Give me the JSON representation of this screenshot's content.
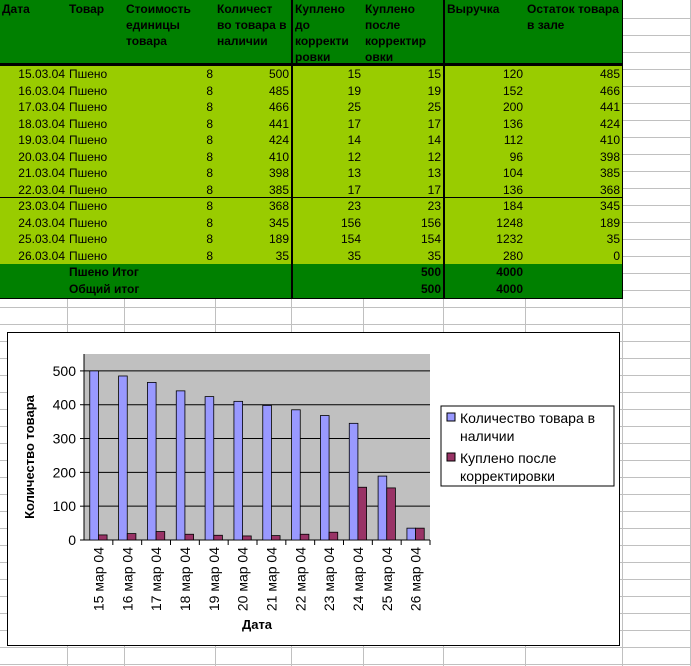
{
  "table": {
    "headers": [
      "Дата",
      "Товар",
      "Стоимость единицы товара",
      "Количест во товара в наличии",
      "Куплено до корректи ровки",
      "Куплено после корректир овки",
      "Выручка",
      "Остаток товара в зале"
    ],
    "rows": [
      [
        "15.03.04",
        "Пшено",
        "8",
        "500",
        "15",
        "15",
        "120",
        "485"
      ],
      [
        "16.03.04",
        "Пшено",
        "8",
        "485",
        "19",
        "19",
        "152",
        "466"
      ],
      [
        "17.03.04",
        "Пшено",
        "8",
        "466",
        "25",
        "25",
        "200",
        "441"
      ],
      [
        "18.03.04",
        "Пшено",
        "8",
        "441",
        "17",
        "17",
        "136",
        "424"
      ],
      [
        "19.03.04",
        "Пшено",
        "8",
        "424",
        "14",
        "14",
        "112",
        "410"
      ],
      [
        "20.03.04",
        "Пшено",
        "8",
        "410",
        "12",
        "12",
        "96",
        "398"
      ],
      [
        "21.03.04",
        "Пшено",
        "8",
        "398",
        "13",
        "13",
        "104",
        "385"
      ],
      [
        "22.03.04",
        "Пшено",
        "8",
        "385",
        "17",
        "17",
        "136",
        "368"
      ],
      [
        "23.03.04",
        "Пшено",
        "8",
        "368",
        "23",
        "23",
        "184",
        "345"
      ],
      [
        "24.03.04",
        "Пшено",
        "8",
        "345",
        "156",
        "156",
        "1248",
        "189"
      ],
      [
        "25.03.04",
        "Пшено",
        "8",
        "189",
        "154",
        "154",
        "1232",
        "35"
      ],
      [
        "26.03.04",
        "Пшено",
        "8",
        "35",
        "35",
        "35",
        "280",
        "0"
      ]
    ],
    "totals": [
      {
        "label": "Пшено Итог",
        "bought_after": "500",
        "revenue": "4000"
      },
      {
        "label": "Общий итог",
        "bought_after": "500",
        "revenue": "4000"
      }
    ],
    "colors": {
      "header": "#008000",
      "data": "#99CC00"
    }
  },
  "chart_data": {
    "type": "bar",
    "xlabel": "Дата",
    "ylabel": "Количество товара",
    "categories": [
      "15 мар 04",
      "16 мар 04",
      "17 мар 04",
      "18 мар 04",
      "19 мар 04",
      "20 мар 04",
      "21 мар 04",
      "22 мар 04",
      "23 мар 04",
      "24 мар 04",
      "25 мар 04",
      "26 мар 04"
    ],
    "series": [
      {
        "name": "Количество товара в наличии",
        "values": [
          500,
          485,
          466,
          441,
          424,
          410,
          398,
          385,
          368,
          345,
          189,
          35
        ],
        "color": "#9999FF"
      },
      {
        "name": "Куплено после корректировки",
        "values": [
          15,
          19,
          25,
          17,
          14,
          12,
          13,
          17,
          23,
          156,
          154,
          35
        ],
        "color": "#993366"
      }
    ],
    "ylim": [
      0,
      550
    ],
    "yticks": [
      "0",
      "100",
      "200",
      "300",
      "400",
      "500"
    ],
    "grid": true,
    "legend": "right",
    "plot_background": "#C0C0C0"
  }
}
